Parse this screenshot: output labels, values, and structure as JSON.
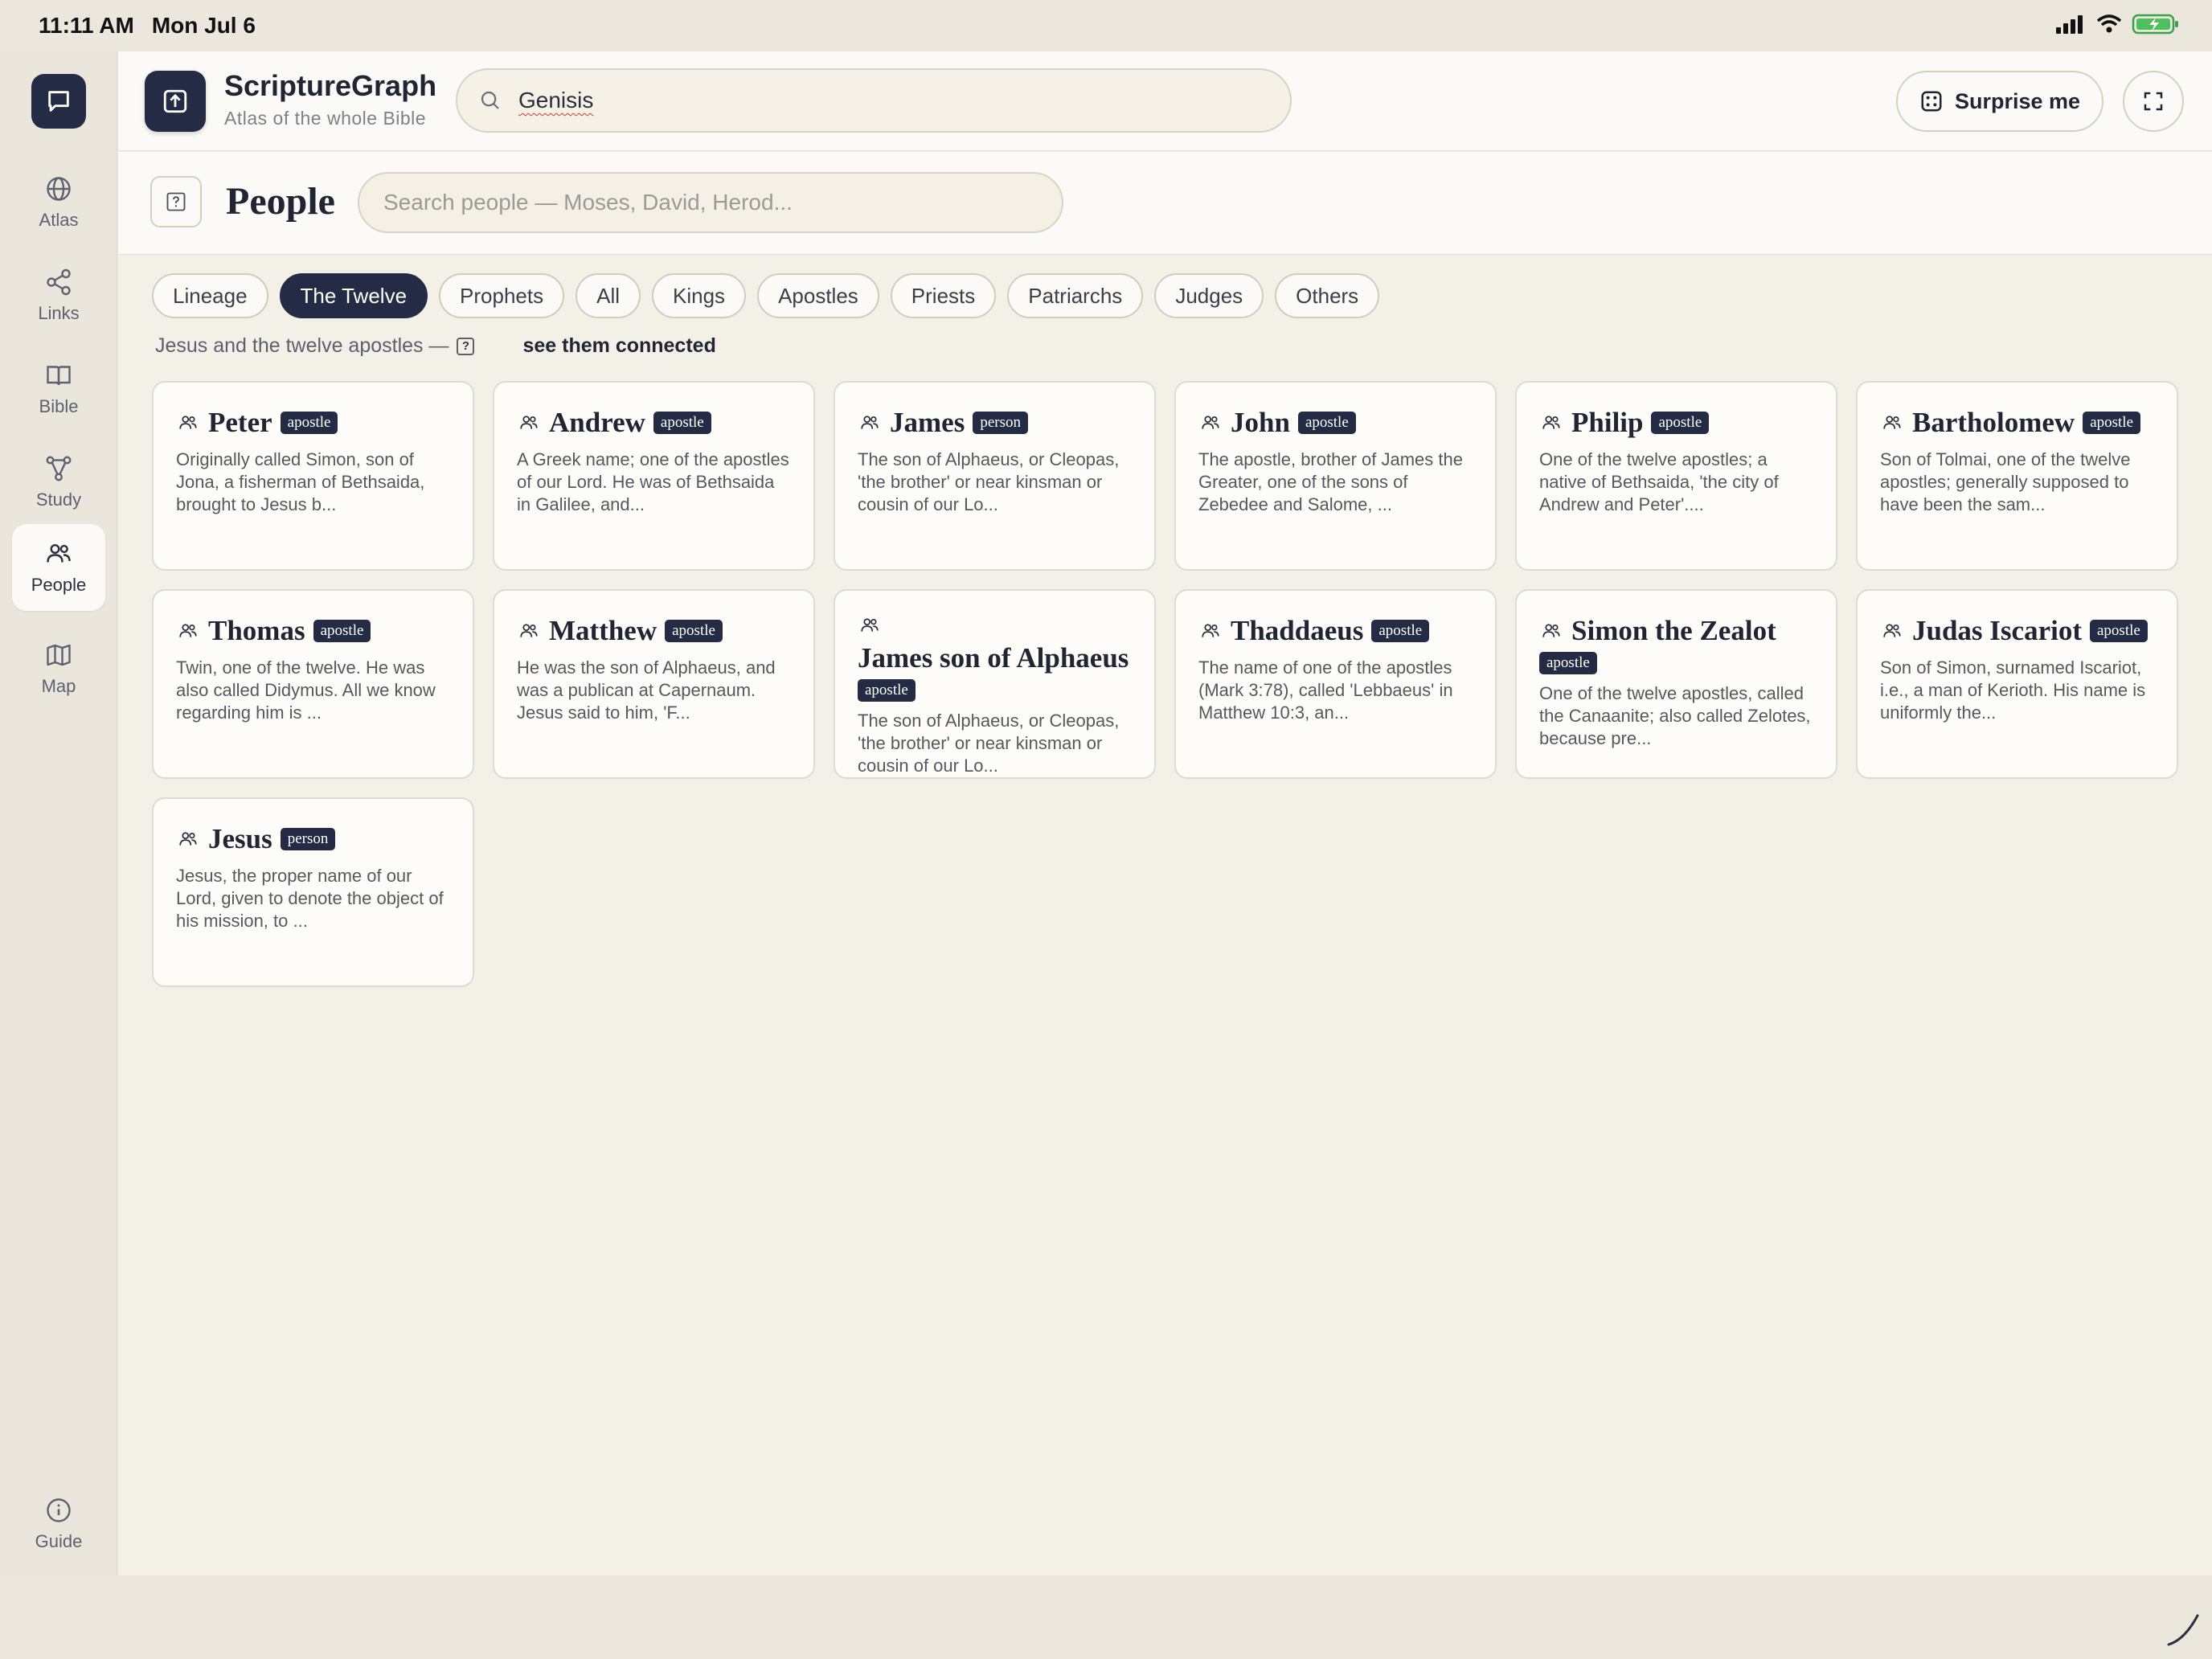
{
  "status": {
    "time": "11:11 AM",
    "date": "Mon Jul 6"
  },
  "rail": {
    "items": [
      {
        "label": "Atlas",
        "icon": "globe-icon"
      },
      {
        "label": "Links",
        "icon": "share-icon"
      },
      {
        "label": "Bible",
        "icon": "book-icon"
      },
      {
        "label": "Study",
        "icon": "graph-icon"
      },
      {
        "label": "People",
        "icon": "people-icon",
        "active": true
      },
      {
        "label": "Map",
        "icon": "map-icon"
      }
    ],
    "guide_label": "Guide"
  },
  "topbar": {
    "title": "ScriptureGraph",
    "subtitle": "Atlas of the whole Bible",
    "search_value": "Genisis",
    "surprise_label": "Surprise me"
  },
  "people": {
    "title": "People",
    "search_placeholder": "Search people — Moses, David, Herod..."
  },
  "chips": [
    {
      "label": "Lineage",
      "active": false
    },
    {
      "label": "The Twelve",
      "active": true
    },
    {
      "label": "Prophets",
      "active": false
    },
    {
      "label": "All",
      "active": false
    },
    {
      "label": "Kings",
      "active": false
    },
    {
      "label": "Apostles",
      "active": false
    },
    {
      "label": "Priests",
      "active": false
    },
    {
      "label": "Patriarchs",
      "active": false
    },
    {
      "label": "Judges",
      "active": false
    },
    {
      "label": "Others",
      "active": false
    }
  ],
  "subline": {
    "text": "Jesus and the twelve apostles —",
    "link": "see them connected"
  },
  "cards": [
    {
      "name": "Peter",
      "badge": "apostle",
      "desc": "Originally called Simon, son of Jona, a fisherman of Bethsaida, brought to Jesus b..."
    },
    {
      "name": "Andrew",
      "badge": "apostle",
      "desc": "A Greek name; one of the apostles of our Lord. He was of Bethsaida in Galilee, and..."
    },
    {
      "name": "James",
      "badge": "person",
      "desc": "The son of Alphaeus, or Cleopas, 'the brother' or near kinsman or cousin of our Lo..."
    },
    {
      "name": "John",
      "badge": "apostle",
      "desc": "The apostle, brother of James the Greater, one of the sons of Zebedee and Salome, ..."
    },
    {
      "name": "Philip",
      "badge": "apostle",
      "desc": "One of the twelve apostles; a native of Bethsaida, 'the city of Andrew and Peter'...."
    },
    {
      "name": "Bartholomew",
      "badge": "apostle",
      "desc": "Son of Tolmai, one of the twelve apostles; generally supposed to have been the sam..."
    },
    {
      "name": "Thomas",
      "badge": "apostle",
      "desc": "Twin, one of the twelve. He was also called Didymus. All we know regarding him is ..."
    },
    {
      "name": "Matthew",
      "badge": "apostle",
      "desc": "He was the son of Alphaeus, and was a publican at Capernaum. Jesus said to him, 'F..."
    },
    {
      "name": "James son of Alphaeus",
      "badge": "apostle",
      "desc": "The son of Alphaeus, or Cleopas, 'the brother' or near kinsman or cousin of our Lo..."
    },
    {
      "name": "Thaddaeus",
      "badge": "apostle",
      "desc": "The name of one of the apostles (Mark 3:78), called 'Lebbaeus' in Matthew 10:3, an..."
    },
    {
      "name": "Simon the Zealot",
      "badge": "apostle",
      "desc": "One of the twelve apostles, called the Canaanite; also called Zelotes, because pre..."
    },
    {
      "name": "Judas Iscariot",
      "badge": "apostle",
      "desc": "Son of Simon, surnamed Iscariot, i.e., a man of Kerioth. His name is uniformly the..."
    },
    {
      "name": "Jesus",
      "badge": "person",
      "desc": "Jesus, the proper name of our Lord, given to denote the object of his mission, to ..."
    }
  ],
  "colors": {
    "accent": "#232c44",
    "background": "#f3f0e8",
    "card": "#fdfcf8"
  }
}
